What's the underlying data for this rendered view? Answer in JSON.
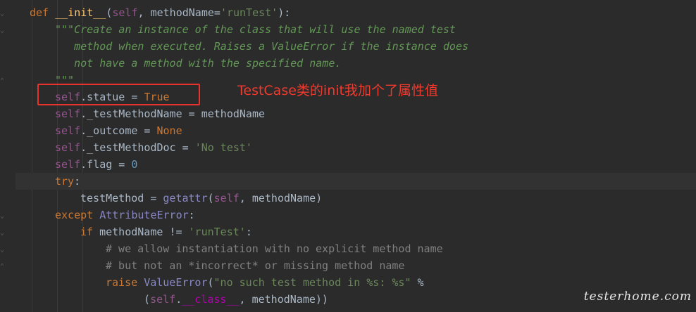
{
  "lines": [
    {
      "tokens": [
        {
          "t": "def ",
          "c": "kw"
        },
        {
          "t": "__init__",
          "c": "fn"
        },
        {
          "t": "(",
          "c": ""
        },
        {
          "t": "self",
          "c": "self"
        },
        {
          "t": ", methodName=",
          "c": ""
        },
        {
          "t": "'runTest'",
          "c": "str"
        },
        {
          "t": "):",
          "c": ""
        }
      ],
      "indent": 0
    },
    {
      "tokens": [
        {
          "t": "\"\"\"Create an instance of the class that will use the named test",
          "c": "doc"
        }
      ],
      "indent": 1
    },
    {
      "tokens": [
        {
          "t": "   method when executed. Raises a ValueError if the instance does",
          "c": "doc"
        }
      ],
      "indent": 1
    },
    {
      "tokens": [
        {
          "t": "   not have a method with the specified name.",
          "c": "doc"
        }
      ],
      "indent": 1
    },
    {
      "tokens": [
        {
          "t": "\"\"\"",
          "c": "doc"
        }
      ],
      "indent": 1
    },
    {
      "tokens": [
        {
          "t": "self",
          "c": "self"
        },
        {
          "t": ".statue = ",
          "c": ""
        },
        {
          "t": "True",
          "c": "kw"
        }
      ],
      "indent": 1
    },
    {
      "tokens": [
        {
          "t": "self",
          "c": "self"
        },
        {
          "t": "._testMethodName = methodName",
          "c": ""
        }
      ],
      "indent": 1
    },
    {
      "tokens": [
        {
          "t": "self",
          "c": "self"
        },
        {
          "t": "._outcome = ",
          "c": ""
        },
        {
          "t": "None",
          "c": "kw"
        }
      ],
      "indent": 1
    },
    {
      "tokens": [
        {
          "t": "self",
          "c": "self"
        },
        {
          "t": "._testMethodDoc = ",
          "c": ""
        },
        {
          "t": "'No test'",
          "c": "str"
        }
      ],
      "indent": 1
    },
    {
      "tokens": [
        {
          "t": "self",
          "c": "self"
        },
        {
          "t": ".flag = ",
          "c": ""
        },
        {
          "t": "0",
          "c": "num"
        }
      ],
      "indent": 1
    },
    {
      "tokens": [
        {
          "t": "try",
          "c": "kw"
        },
        {
          "t": ":",
          "c": ""
        }
      ],
      "indent": 1,
      "highlight": true
    },
    {
      "tokens": [
        {
          "t": "testMethod = ",
          "c": ""
        },
        {
          "t": "getattr",
          "c": "builtin"
        },
        {
          "t": "(",
          "c": ""
        },
        {
          "t": "self",
          "c": "self"
        },
        {
          "t": ", methodName)",
          "c": ""
        }
      ],
      "indent": 2
    },
    {
      "tokens": [
        {
          "t": "except ",
          "c": "kw"
        },
        {
          "t": "AttributeError",
          "c": "builtin"
        },
        {
          "t": ":",
          "c": ""
        }
      ],
      "indent": 1
    },
    {
      "tokens": [
        {
          "t": "if ",
          "c": "kw"
        },
        {
          "t": "methodName != ",
          "c": ""
        },
        {
          "t": "'runTest'",
          "c": "str"
        },
        {
          "t": ":",
          "c": ""
        }
      ],
      "indent": 2
    },
    {
      "tokens": [
        {
          "t": "# we allow instantiation with no explicit method name",
          "c": "cm"
        }
      ],
      "indent": 3
    },
    {
      "tokens": [
        {
          "t": "# but not an *incorrect* or missing method name",
          "c": "cm"
        }
      ],
      "indent": 3
    },
    {
      "tokens": [
        {
          "t": "raise ",
          "c": "kw"
        },
        {
          "t": "ValueError",
          "c": "builtin"
        },
        {
          "t": "(",
          "c": ""
        },
        {
          "t": "\"no such test method in %s: %s\"",
          "c": "str"
        },
        {
          "t": " %",
          "c": ""
        }
      ],
      "indent": 3
    },
    {
      "tokens": [
        {
          "t": "  (",
          "c": ""
        },
        {
          "t": "self",
          "c": "self"
        },
        {
          "t": ".",
          "c": ""
        },
        {
          "t": "__class__",
          "c": "dunder"
        },
        {
          "t": ", methodName))",
          "c": ""
        }
      ],
      "indent": 4
    }
  ],
  "annotation": {
    "text": "TestCase类的init我加个了属性值"
  },
  "watermark": "testerhome.com"
}
